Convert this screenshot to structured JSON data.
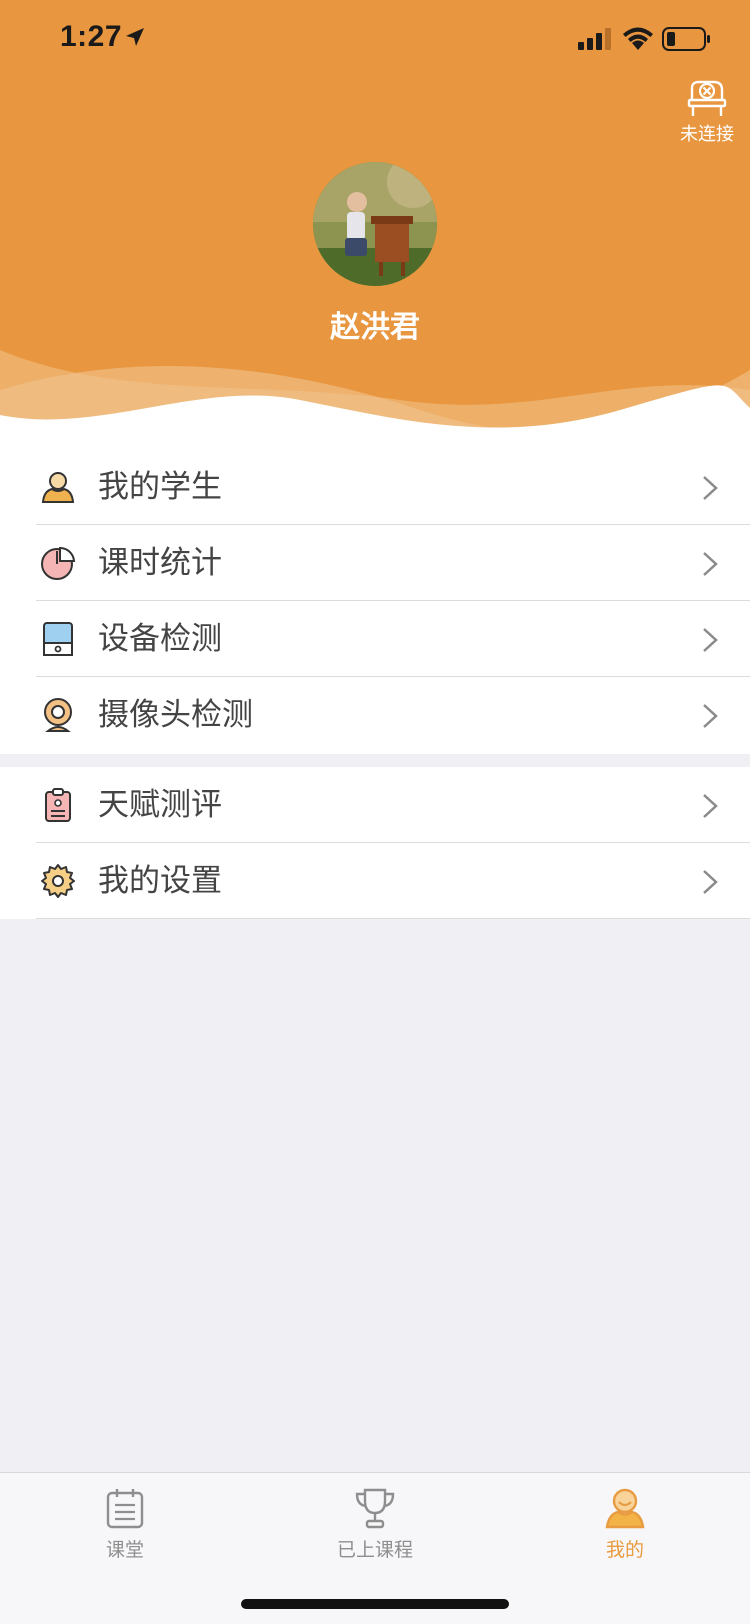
{
  "status_bar": {
    "time": "1:27"
  },
  "device": {
    "connection_label": "未连接"
  },
  "profile": {
    "name": "赵洪君"
  },
  "menu_group_1": [
    {
      "label": "我的学生",
      "icon": "student-icon"
    },
    {
      "label": "课时统计",
      "icon": "pie-chart-icon"
    },
    {
      "label": "设备检测",
      "icon": "tablet-icon"
    },
    {
      "label": "摄像头检测",
      "icon": "camera-icon"
    }
  ],
  "menu_group_2": [
    {
      "label": "天赋测评",
      "icon": "clipboard-icon"
    },
    {
      "label": "我的设置",
      "icon": "gear-icon"
    }
  ],
  "tabs": [
    {
      "label": "课堂",
      "icon": "calendar-icon",
      "active": false
    },
    {
      "label": "已上课程",
      "icon": "trophy-icon",
      "active": false
    },
    {
      "label": "我的",
      "icon": "user-icon",
      "active": true
    }
  ],
  "colors": {
    "accent": "#e8963f",
    "active_tab": "#e89b40",
    "background": "#f0eff4"
  }
}
